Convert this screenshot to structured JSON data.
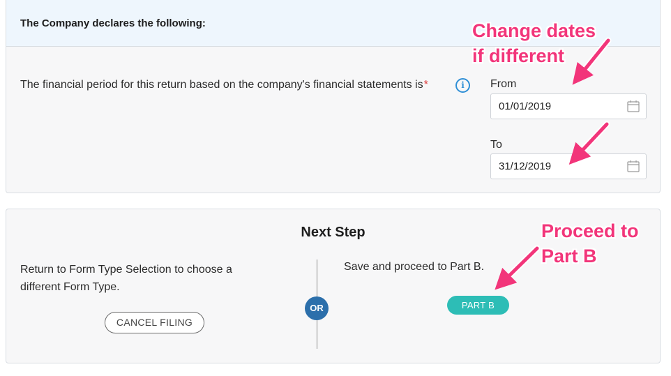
{
  "declaration": {
    "title": "The Company declares the following:",
    "period_text": "The financial period for this return based on the company's financial statements is",
    "required_mark": "*",
    "info_icon": "info-icon",
    "from_label": "From",
    "from_value": "01/01/2019",
    "to_label": "To",
    "to_value": "31/12/2019",
    "calendar_icon": "calendar-icon"
  },
  "next_step": {
    "title": "Next Step",
    "left_text": "Return to Form Type Selection to choose a different Form Type.",
    "cancel_label": "CANCEL FILING",
    "or_label": "OR",
    "right_text": "Save and proceed to Part B.",
    "partb_label": "PART B"
  },
  "annotations": {
    "change_dates_line1": "Change dates",
    "change_dates_line2": "if different",
    "proceed_line1": "Proceed to",
    "proceed_line2": "Part B"
  },
  "colors": {
    "annotation": "#f2357a",
    "accent_teal": "#2dbdb6",
    "or_badge": "#2c6fab",
    "info_blue": "#2f8fd6",
    "header_bg": "#eef6fd"
  }
}
